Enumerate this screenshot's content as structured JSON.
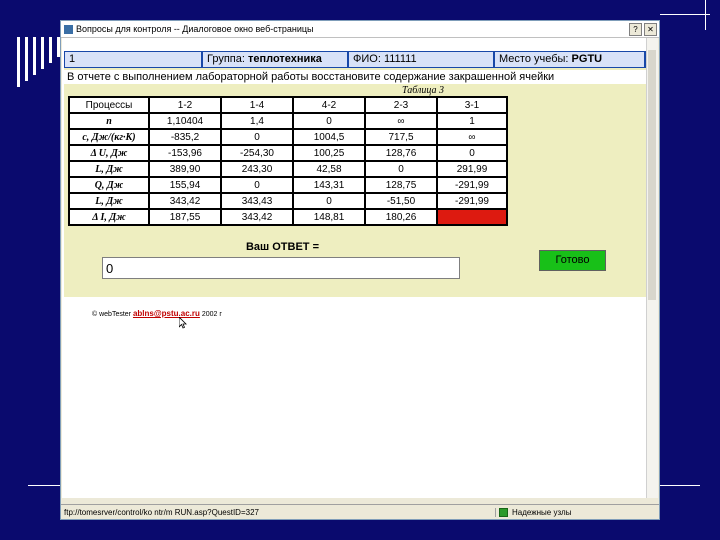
{
  "window": {
    "title": "Вопросы для контроля -- Диалоговое окно веб-страницы",
    "help_glyph": "?",
    "close_glyph": "✕"
  },
  "info": {
    "number": "1",
    "group_label": "Группа:",
    "group_value": "теплотехника",
    "fio_label": "ФИО:",
    "fio_value": "111111",
    "place_label": "Место учебы:",
    "place_value": "PGTU"
  },
  "question_text": "В отчете с выполнением лабораторной работы восстановите содержание закрашенной ячейки",
  "table": {
    "caption": "Таблица 3",
    "header": [
      "Процессы",
      "1-2",
      "1-4",
      "4-2",
      "2-3",
      "3-1"
    ],
    "rows": [
      {
        "label": "n",
        "values": [
          "1,10404",
          "1,4",
          "0",
          "∞",
          "1"
        ]
      },
      {
        "label": "c, Дж/(кг·К)",
        "values": [
          "-835,2",
          "0",
          "1004,5",
          "717,5",
          "∞"
        ]
      },
      {
        "label": "Δ U, Дж",
        "values": [
          "-153,96",
          "-254,30",
          "100,25",
          "128,76",
          "0"
        ]
      },
      {
        "label": "L, Дж",
        "values": [
          "389,90",
          "243,30",
          "42,58",
          "0",
          "291,99"
        ]
      },
      {
        "label": "Q, Дж",
        "values": [
          "155,94",
          "0",
          "143,31",
          "128,75",
          "-291,99"
        ]
      },
      {
        "label": "L, Дж",
        "values": [
          "343,42",
          "343,43",
          "0",
          "-51,50",
          "-291,99"
        ]
      },
      {
        "label": "Δ I, Дж",
        "values": [
          "187,55",
          "343,42",
          "148,81",
          "180,26",
          ""
        ]
      }
    ]
  },
  "answer": {
    "label": "Ваш ОТВЕТ =",
    "value": "0",
    "submit_label": "Готово"
  },
  "footer": {
    "prefix": "© webTester",
    "email": "ablns@pstu.ac.ru",
    "year": "2002 г"
  },
  "status": {
    "url": "ftp://tomesrver/control/ko ntr/m RUN.asp?QuestID=327",
    "zone": "Надежные узлы"
  },
  "colors": {
    "slide_background": "#0a0a6e",
    "info_bar": "#1848a8",
    "highlight_cell": "#dd1a10",
    "submit_button": "#18c018",
    "answer_panel": "#eeeec0"
  }
}
